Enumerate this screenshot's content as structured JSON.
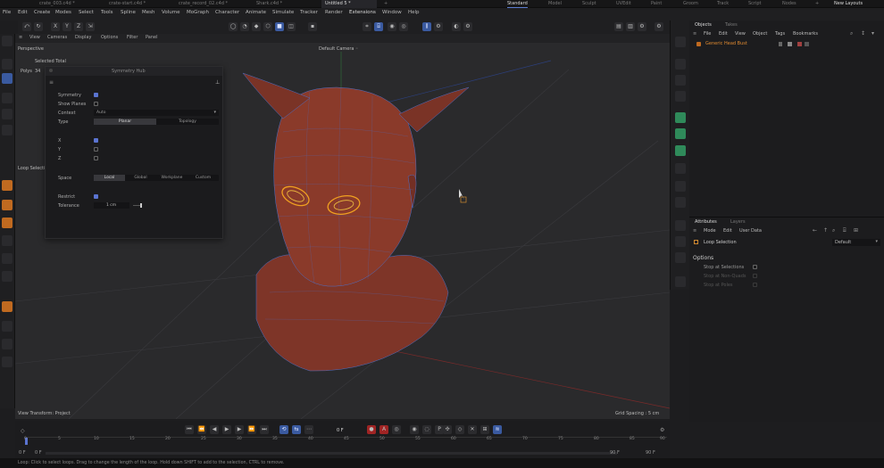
{
  "file_tabs": [
    "crate_003.c4d *",
    "crate-start.c4d *",
    "crate_record_02.c4d *",
    "Shark.c4d *",
    "Untitled 5 *"
  ],
  "file_tab_add": "+",
  "layout_tabs": [
    "Standard",
    "Model",
    "Sculpt",
    "UVEdit",
    "Paint",
    "Groom",
    "Track",
    "Script",
    "Nodes"
  ],
  "layout_add": "+",
  "new_layouts": "New Layouts",
  "menu": [
    "File",
    "Edit",
    "Create",
    "Modes",
    "Select",
    "Tools",
    "Spline",
    "Mesh",
    "Volume",
    "MoGraph",
    "Character",
    "Animate",
    "Simulate",
    "Tracker",
    "Render",
    "Extensions",
    "Window",
    "Help"
  ],
  "axis": {
    "x": "X",
    "y": "Y",
    "z": "Z"
  },
  "viewport": {
    "menu": [
      "View",
      "Cameras",
      "Display",
      "Options",
      "Filter",
      "Panel"
    ],
    "perspective": "Perspective",
    "camera": "Default Camera ◦",
    "selected_total": "Selected  Total",
    "polys_label": "Polys",
    "polys_value": "34",
    "loop_select": "Loop Selection",
    "view_transform": "View Transform: Project",
    "grid_spacing": "Grid Spacing : 5 cm"
  },
  "symmetry_panel": {
    "title": "Symmetry Hub",
    "rows": {
      "symmetry": "Symmetry",
      "show_planes": "Show Planes",
      "context": "Context",
      "context_value": "Auto",
      "type": "Type",
      "planar": "Planar",
      "topology": "Topology",
      "x": "X",
      "y": "Y",
      "z": "Z",
      "space": "Space",
      "local": "Local",
      "global": "Global",
      "workplane": "Workplane",
      "custom": "Custom",
      "restrict": "Restrict",
      "tolerance": "Tolerance",
      "tolerance_value": "1 cm"
    }
  },
  "objects_panel": {
    "tabs": [
      "Objects",
      "Takes"
    ],
    "menu": [
      "File",
      "Edit",
      "View",
      "Object",
      "Tags",
      "Bookmarks"
    ],
    "item": "Generic Head Bust"
  },
  "attributes_panel": {
    "tabs": [
      "Attributes",
      "Layers"
    ],
    "menu": [
      "Mode",
      "Edit",
      "User Data"
    ],
    "tool": "Loop Selection",
    "preset": "Default",
    "section": "Options",
    "options": [
      "Stop at Selections",
      "Stop at Non-Quads",
      "Stop at Poles"
    ]
  },
  "timeline": {
    "current_frame": "0 F",
    "ticks": [
      "0",
      "5",
      "10",
      "15",
      "20",
      "25",
      "30",
      "35",
      "40",
      "45",
      "50",
      "55",
      "60",
      "65",
      "70",
      "75",
      "80",
      "85",
      "90"
    ],
    "start": "0 F",
    "start2": "0 F",
    "end": "90 F",
    "end2": "90 F"
  },
  "status_text": "Loop: Click to select loops. Drag to change the length of the loop. Hold down SHIFT to add to the selection, CTRL to remove.",
  "colors": {
    "accent": "#5b74d1",
    "model": "#8a3a2a",
    "wire": "#5e7fd6",
    "loop": "#f0a020"
  }
}
